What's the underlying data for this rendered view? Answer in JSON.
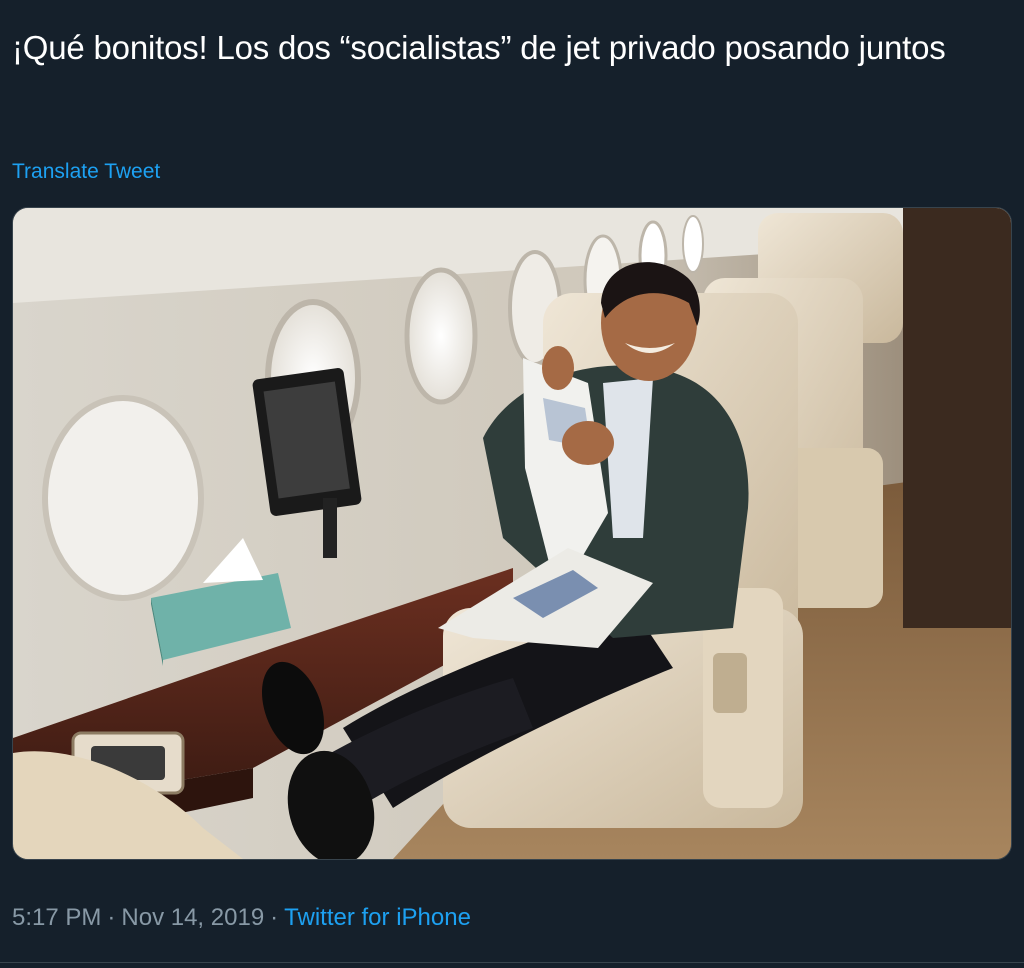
{
  "tweet": {
    "text": "¡Qué bonitos! Los dos “socialistas” de jet privado posando juntos",
    "translate_label": "Translate Tweet",
    "time": "5:17 PM",
    "separator": "·",
    "date": "Nov 14, 2019",
    "source": "Twitter for iPhone"
  },
  "colors": {
    "background": "#15202b",
    "text": "#ffffff",
    "link": "#1da1f2",
    "secondary": "#8899a6",
    "border": "#38444d"
  }
}
